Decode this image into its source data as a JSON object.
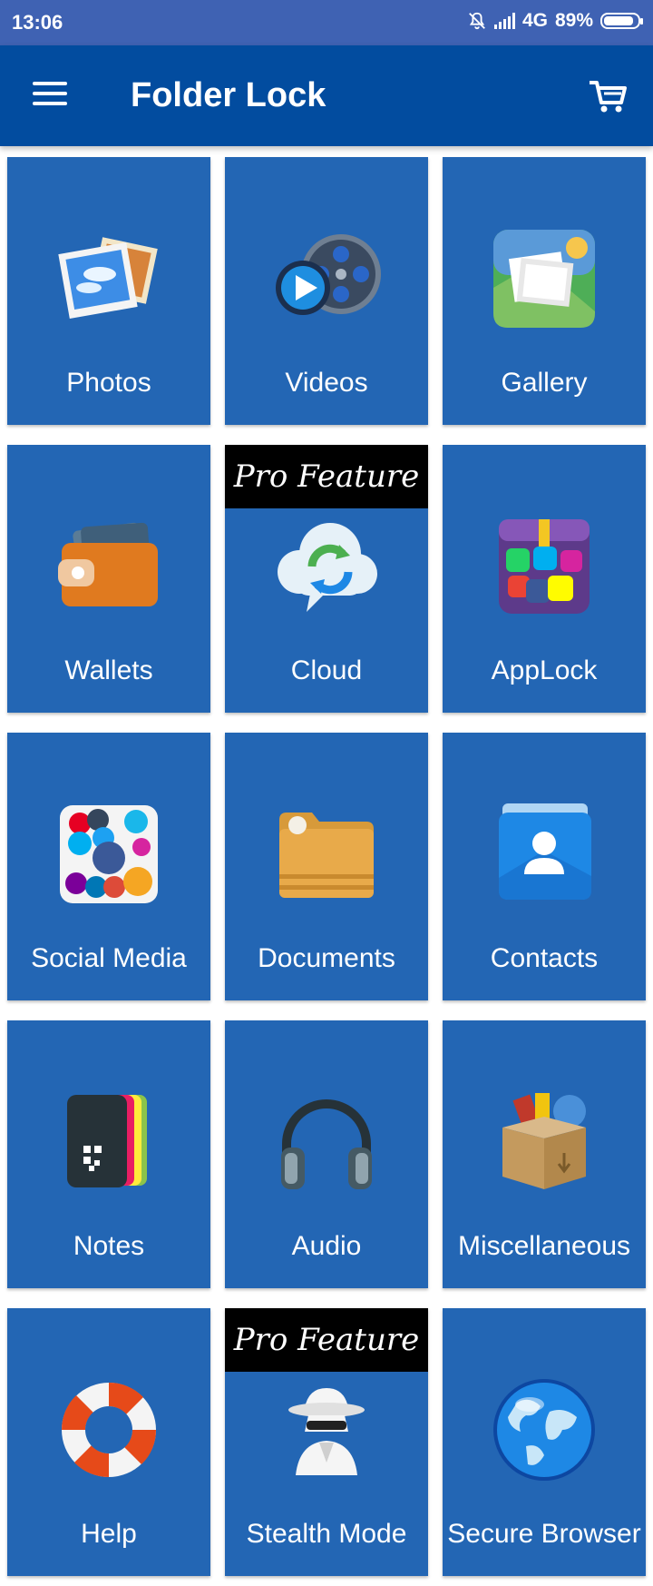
{
  "status_bar": {
    "time": "13:06",
    "network": "4G",
    "battery": "89%",
    "battery_level": 0.89
  },
  "app_bar": {
    "title": "Folder Lock"
  },
  "tiles": [
    {
      "label": "Photos"
    },
    {
      "label": "Videos"
    },
    {
      "label": "Gallery"
    },
    {
      "label": "Wallets"
    },
    {
      "label": "Cloud",
      "badge": "Pro Feature"
    },
    {
      "label": "AppLock"
    },
    {
      "label": "Social Media"
    },
    {
      "label": "Documents"
    },
    {
      "label": "Contacts"
    },
    {
      "label": "Notes"
    },
    {
      "label": "Audio"
    },
    {
      "label": "Miscellaneous"
    },
    {
      "label": "Help"
    },
    {
      "label": "Stealth Mode",
      "badge": "Pro Feature"
    },
    {
      "label": "Secure Browser"
    }
  ],
  "colors": {
    "status_bar": "#3f62b3",
    "app_bar": "#024c9f",
    "tile": "#2366b4"
  }
}
